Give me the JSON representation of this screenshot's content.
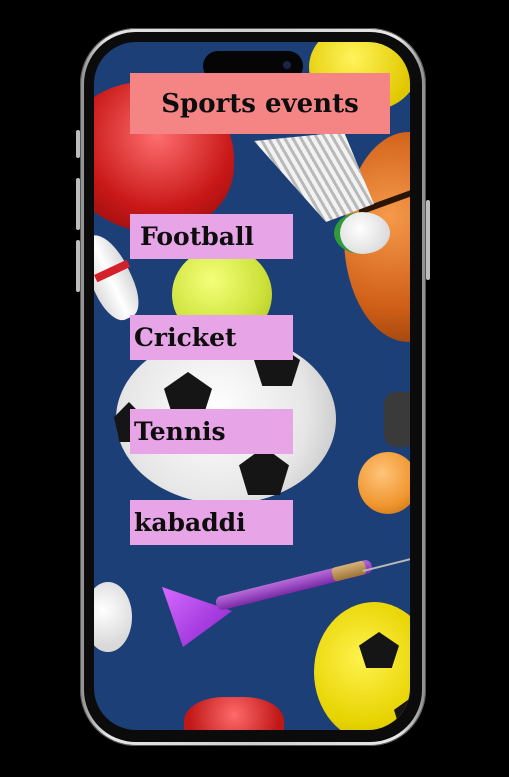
{
  "app": {
    "title": "Sports events"
  },
  "events": [
    {
      "label": "Football"
    },
    {
      "label": "Cricket"
    },
    {
      "label": "Tennis"
    },
    {
      "label": "kabaddi"
    }
  ],
  "colors": {
    "title_bg": "#f58585",
    "button_bg": "#e7a4e6",
    "screen_bg": "#1d3f78",
    "outer_bg": "#000000"
  },
  "background": {
    "icons": [
      "boxing-glove-icon",
      "shuttlecock-icon",
      "basketball-icon",
      "bowling-pin-icon",
      "tennis-ball-icon",
      "soccer-ball-icon",
      "golf-ball-icon",
      "dart-icon"
    ]
  }
}
